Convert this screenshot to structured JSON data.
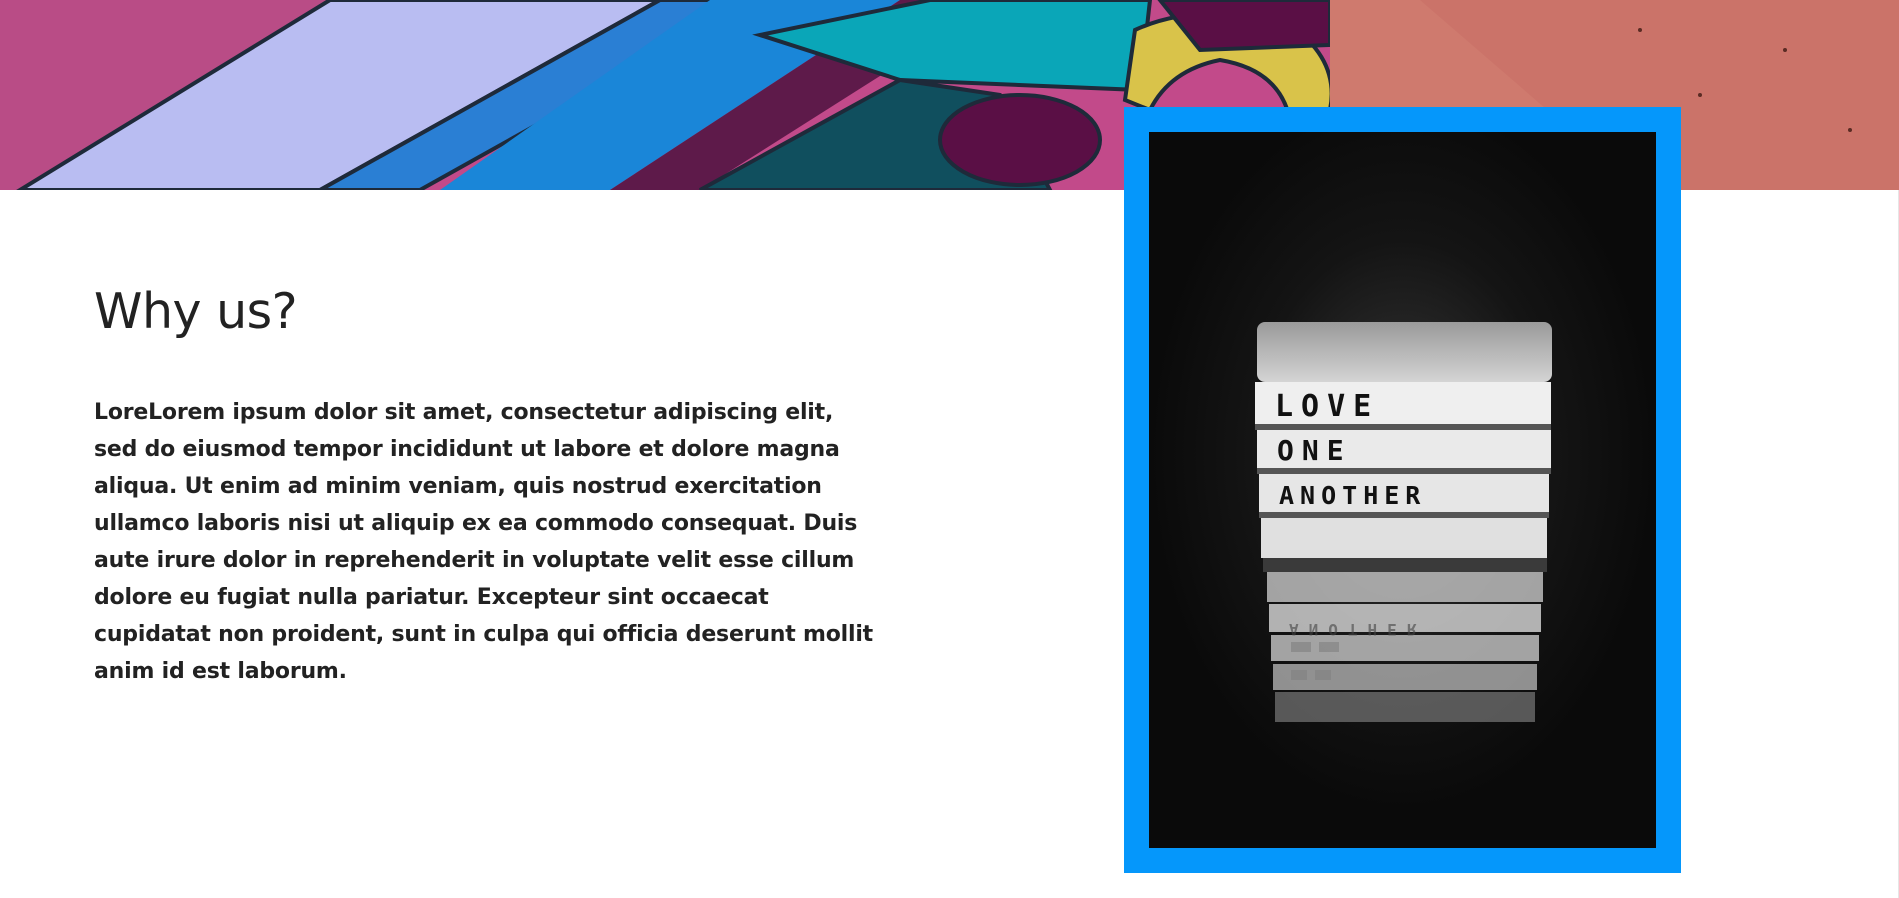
{
  "hero": {
    "image_name": "colorful-mural-banner"
  },
  "section": {
    "heading": "Why us?",
    "body": "LoreLorem ipsum dolor sit amet, consectetur adipiscing elit, sed do eiusmod tempor incididunt ut labore et dolore magna aliqua. Ut enim ad minim veniam, quis nostrud exercitation ullamco laboris nisi ut aliquip ex ea commodo consequat. Duis aute irure dolor in reprehenderit in voluptate velit esse cillum dolore eu fugiat nulla pariatur. Excepteur sint occaecat cupidatat non proident, sunt in culpa qui officia deserunt mollit anim id est laborum."
  },
  "photo": {
    "image_name": "lightbox-sign-photo",
    "frame_color": "#0597fb",
    "sign_lines": [
      "LOVE",
      "ONE",
      "ANOTHER"
    ]
  }
}
